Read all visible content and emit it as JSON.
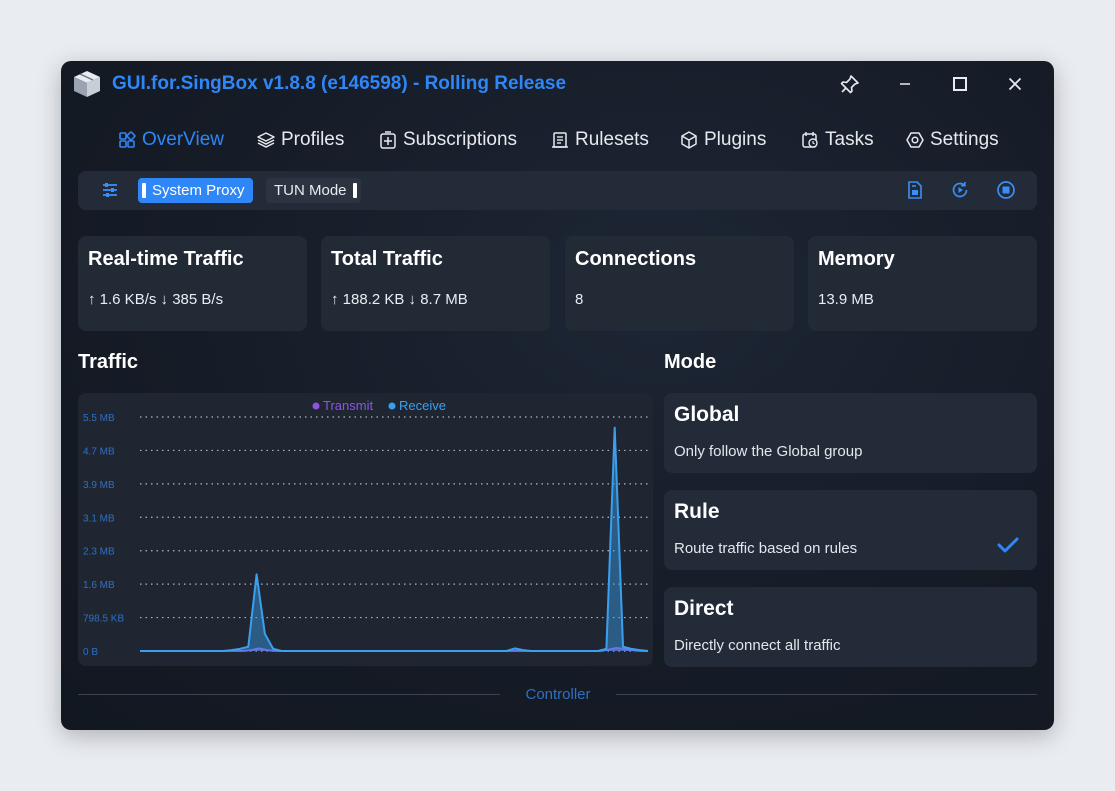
{
  "window": {
    "title": "GUI.for.SingBox v1.8.8 (e146598) - Rolling Release",
    "accent_color": "#2f86f6"
  },
  "nav": {
    "items": [
      {
        "label": "OverView",
        "icon": "overview-icon",
        "active": true
      },
      {
        "label": "Profiles",
        "icon": "layers-icon"
      },
      {
        "label": "Subscriptions",
        "icon": "subscriptions-icon"
      },
      {
        "label": "Rulesets",
        "icon": "rulesets-icon"
      },
      {
        "label": "Plugins",
        "icon": "plugin-cube-icon"
      },
      {
        "label": "Tasks",
        "icon": "calendar-clock-icon"
      },
      {
        "label": "Settings",
        "icon": "gear-icon"
      }
    ]
  },
  "toolbar": {
    "system_proxy": {
      "label": "System Proxy",
      "enabled": true
    },
    "tun_mode": {
      "label": "TUN Mode",
      "enabled": false
    },
    "icons": [
      "sliders-icon",
      "save-file-icon",
      "restart-icon",
      "stop-icon"
    ]
  },
  "stats": {
    "realtime": {
      "title": "Real-time Traffic",
      "value": "↑ 1.6 KB/s ↓ 385 B/s"
    },
    "total": {
      "title": "Total Traffic",
      "value": "↑ 188.2 KB ↓ 8.7 MB"
    },
    "connections": {
      "title": "Connections",
      "value": "8"
    },
    "memory": {
      "title": "Memory",
      "value": "13.9 MB"
    }
  },
  "traffic": {
    "title": "Traffic"
  },
  "chart_data": {
    "type": "area",
    "y_tick_labels": [
      "0 B",
      "798.5 KB",
      "1.6 MB",
      "2.3 MB",
      "3.1 MB",
      "3.9 MB",
      "4.7 MB",
      "5.5 MB"
    ],
    "ylim": [
      0,
      5.5
    ],
    "y_unit": "MB",
    "grid": true,
    "legend_position": "top-center",
    "series": [
      {
        "name": "Transmit",
        "color": "#8a56e0",
        "values": [
          0,
          0,
          0,
          0,
          0,
          0,
          0,
          0,
          0,
          0,
          0,
          0,
          0,
          0,
          0.02,
          0.06,
          0.02,
          0,
          0,
          0,
          0,
          0,
          0,
          0,
          0,
          0,
          0,
          0,
          0,
          0,
          0,
          0,
          0,
          0,
          0,
          0,
          0,
          0,
          0,
          0,
          0,
          0,
          0,
          0,
          0,
          0,
          0,
          0,
          0,
          0,
          0,
          0,
          0,
          0,
          0,
          0,
          0,
          0,
          0,
          0.03,
          0.07,
          0.05,
          0.02,
          0,
          0
        ]
      },
      {
        "name": "Receive",
        "color": "#3aa0ee",
        "values": [
          0,
          0,
          0,
          0,
          0,
          0,
          0,
          0,
          0,
          0,
          0,
          0.02,
          0.05,
          0.1,
          1.8,
          0.4,
          0.05,
          0,
          0,
          0,
          0,
          0,
          0,
          0,
          0,
          0,
          0,
          0,
          0,
          0,
          0,
          0,
          0,
          0,
          0,
          0,
          0,
          0,
          0,
          0,
          0,
          0,
          0,
          0,
          0,
          0.06,
          0.02,
          0,
          0,
          0,
          0,
          0,
          0,
          0,
          0,
          0,
          0.05,
          5.25,
          0.1,
          0.05,
          0.02,
          0
        ]
      }
    ]
  },
  "mode": {
    "title": "Mode",
    "options": [
      {
        "name": "Global",
        "description": "Only follow the Global group",
        "selected": false
      },
      {
        "name": "Rule",
        "description": "Route traffic based on rules",
        "selected": true
      },
      {
        "name": "Direct",
        "description": "Directly connect all traffic",
        "selected": false
      }
    ]
  },
  "controller": {
    "label": "Controller"
  }
}
